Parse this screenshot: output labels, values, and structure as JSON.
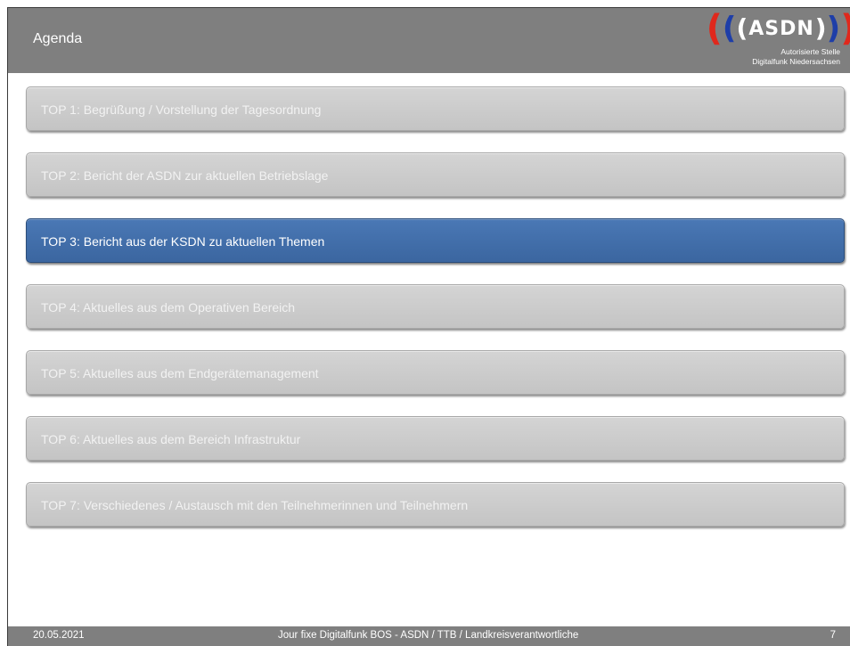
{
  "header": {
    "title": "Agenda"
  },
  "logo": {
    "text": "ASDN",
    "subtitle_line1": "Autorisierte Stelle",
    "subtitle_line2": "Digitalfunk Niedersachsen",
    "colors": {
      "red": "#e0281c",
      "blue": "#1e3ea8"
    }
  },
  "agenda": {
    "items": [
      {
        "label": "TOP 1: Begrüßung / Vorstellung der Tagesordnung",
        "active": false
      },
      {
        "label": "TOP 2: Bericht der ASDN zur aktuellen Betriebslage",
        "active": false
      },
      {
        "label": "TOP 3: Bericht aus der KSDN zu aktuellen Themen",
        "active": true
      },
      {
        "label": "TOP 4: Aktuelles aus dem Operativen Bereich",
        "active": false
      },
      {
        "label": "TOP 5: Aktuelles aus dem Endgerätemanagement",
        "active": false
      },
      {
        "label": "TOP 6: Aktuelles aus dem Bereich Infrastruktur",
        "active": false
      },
      {
        "label": "TOP 7: Verschiedenes / Austausch mit den Teilnehmerinnen und Teilnehmern",
        "active": false
      }
    ],
    "colors": {
      "inactive": "#c8c8c8",
      "active": "#3f6ca8"
    }
  },
  "footer": {
    "date": "20.05.2021",
    "center": "Jour fixe Digitalfunk BOS - ASDN / TTB / Landkreisverantwortliche",
    "page": "7"
  },
  "colors": {
    "bar": "#7f7f7f"
  }
}
